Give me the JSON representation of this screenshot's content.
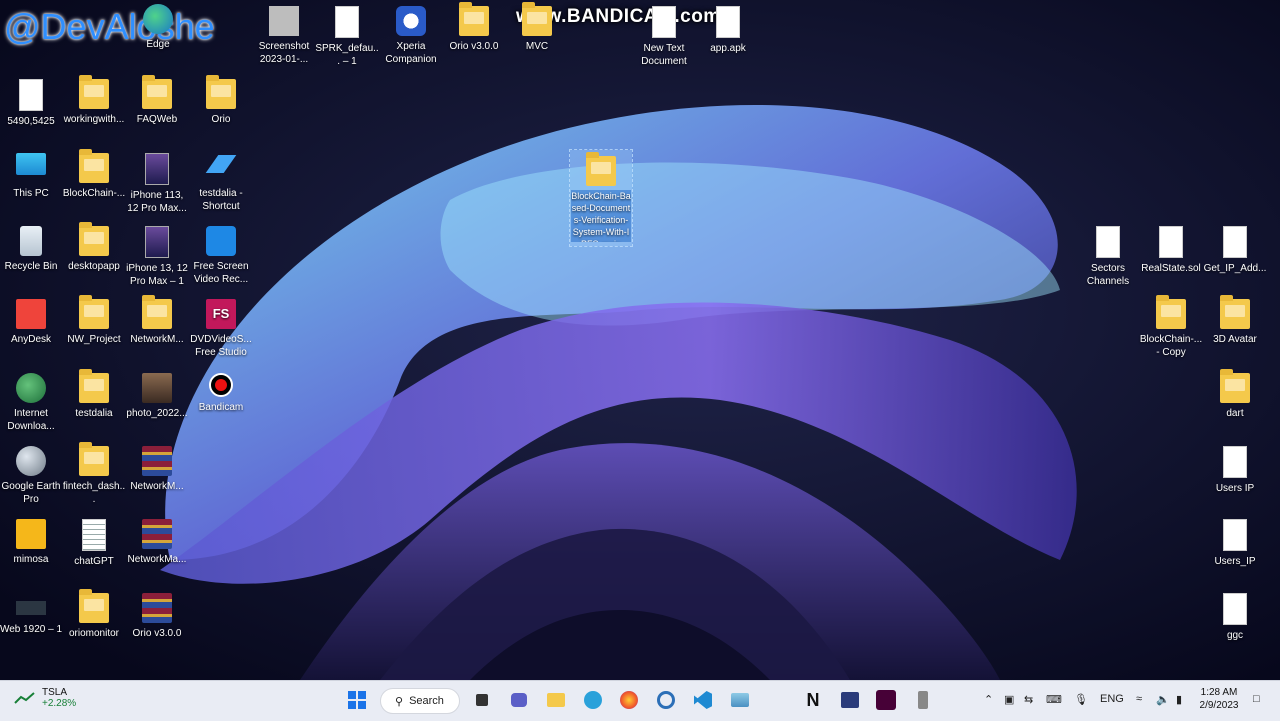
{
  "watermarks": {
    "bandicam": "www.BANDICAM.com",
    "user": "@DevAloshe"
  },
  "desktop": {
    "top_row": [
      {
        "label": "Edge",
        "type": "edge"
      },
      {
        "label": "Screenshot 2023-01-...",
        "type": "gray"
      },
      {
        "label": "SPRK_defau... – 1",
        "type": "doc"
      },
      {
        "label": "Xperia Companion",
        "type": "xperia"
      },
      {
        "label": "Orio v3.0.0",
        "type": "folder"
      },
      {
        "label": "MVC",
        "type": "folder"
      },
      {
        "label": "New Text Document",
        "type": "doc"
      },
      {
        "label": "app.apk",
        "type": "doc"
      }
    ],
    "col1": [
      {
        "label": "5490,5425",
        "type": "doc"
      },
      {
        "label": "This PC",
        "type": "monitor"
      },
      {
        "label": "Recycle Bin",
        "type": "bin"
      },
      {
        "label": "AnyDesk",
        "type": "anydesk"
      },
      {
        "label": "Internet Downloa...",
        "type": "idm"
      },
      {
        "label": "Google Earth Pro",
        "type": "gearth"
      },
      {
        "label": "mimosa",
        "type": "mimosa"
      },
      {
        "label": "Web 1920 – 1",
        "type": "web"
      }
    ],
    "col2": [
      {
        "label": "workingwith...",
        "type": "folder"
      },
      {
        "label": "BlockChain-...",
        "type": "folder"
      },
      {
        "label": "desktopapp",
        "type": "folder"
      },
      {
        "label": "NW_Project",
        "type": "folder"
      },
      {
        "label": "testdalia",
        "type": "folder"
      },
      {
        "label": "fintech_dash...",
        "type": "folder"
      },
      {
        "label": "chatGPT",
        "type": "doc-lines"
      },
      {
        "label": "oriomonitor",
        "type": "folder"
      }
    ],
    "col3": [
      {
        "label": "FAQWeb",
        "type": "folder"
      },
      {
        "label": "iPhone 113, 12 Pro Max...",
        "type": "phone"
      },
      {
        "label": "iPhone 13, 12 Pro Max – 1",
        "type": "phone"
      },
      {
        "label": "NetworkM...",
        "type": "folder"
      },
      {
        "label": "photo_2022...",
        "type": "photo"
      },
      {
        "label": "NetworkM...",
        "type": "rar"
      },
      {
        "label": "NetworkMa...",
        "type": "rar"
      },
      {
        "label": "Orio v3.0.0",
        "type": "rar"
      }
    ],
    "col4": [
      {
        "label": "Orio",
        "type": "folder"
      },
      {
        "label": "testdalia - Shortcut",
        "type": "flutter"
      },
      {
        "label": "Free Screen Video Rec...",
        "type": "screenrec"
      },
      {
        "label": "DVDVideoS... Free Studio",
        "type": "fs",
        "glyph_text": "FS"
      },
      {
        "label": "Bandicam",
        "type": "bandicam"
      }
    ],
    "selected_icon": {
      "label": "BlockChain-Based-Documents-Verification-System-With-IPFS-main",
      "type": "folder"
    },
    "right_icons": [
      {
        "label": "Sectors Channels",
        "type": "doc"
      },
      {
        "label": "RealState.sol",
        "type": "doc"
      },
      {
        "label": "Get_IP_Add...",
        "type": "doc"
      },
      {
        "label": "BlockChain-... - Copy",
        "type": "folder"
      },
      {
        "label": "3D Avatar",
        "type": "folder"
      },
      {
        "label": "dart",
        "type": "folder"
      },
      {
        "label": "Users IP",
        "type": "doc"
      },
      {
        "label": "Users_IP",
        "type": "doc"
      },
      {
        "label": "ggc",
        "type": "doc"
      }
    ]
  },
  "taskbar": {
    "stock": {
      "name": "TSLA",
      "change": "+2.28%"
    },
    "search_label": "Search",
    "apps": [
      "start",
      "search",
      "task-view",
      "teams",
      "file-explorer",
      "telegram",
      "firefox",
      "edge-alt",
      "vscode",
      "photos",
      "notion",
      "powershell",
      "xd",
      "app"
    ],
    "tray": {
      "language": "ENG"
    },
    "clock": {
      "time": "1:28 AM",
      "date": "2/9/2023"
    }
  }
}
